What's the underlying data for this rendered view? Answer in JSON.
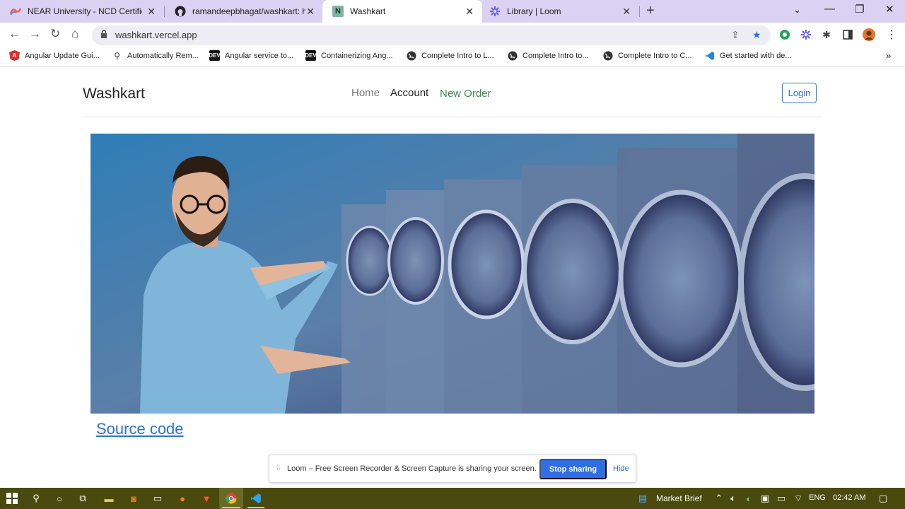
{
  "browser": {
    "tabs": [
      {
        "title": "NEAR University - NCD Certificate",
        "favicon": "near-icon"
      },
      {
        "title": "ramandeepbhagat/washkart: https",
        "favicon": "github-icon"
      },
      {
        "title": "Washkart",
        "favicon": "notion-n-icon"
      },
      {
        "title": "Library | Loom",
        "favicon": "loom-icon"
      }
    ],
    "url": "washkart.vercel.app",
    "bookmarks": [
      {
        "label": "Angular Update Gui...",
        "icon": "angular-icon"
      },
      {
        "label": "Automatically Rem...",
        "icon": "link-icon"
      },
      {
        "label": "Angular service to...",
        "icon": "dev-icon",
        "badge": "DEV"
      },
      {
        "label": "Containerizing Ang...",
        "icon": "dev-icon",
        "badge": "DEV"
      },
      {
        "label": "Complete Intro to L...",
        "icon": "globe-icon"
      },
      {
        "label": "Complete Intro to...",
        "icon": "globe-icon"
      },
      {
        "label": "Complete Intro to C...",
        "icon": "globe-icon"
      },
      {
        "label": "Get started with de...",
        "icon": "vscode-icon"
      }
    ],
    "more_bookmarks": "»"
  },
  "page": {
    "brand": "Washkart",
    "nav": {
      "home": "Home",
      "account": "Account",
      "new_order": "New Order"
    },
    "login": "Login",
    "source_link": "Source code"
  },
  "loom": {
    "grip": "⁞⁞",
    "message": "Loom – Free Screen Recorder & Screen Capture is sharing your screen.",
    "stop": "Stop sharing",
    "hide": "Hide"
  },
  "taskbar": {
    "market": "Market Brief",
    "lang": "ENG",
    "time": "02:42 AM"
  },
  "colors": {
    "accent": "#2e6fe6",
    "nav_green": "#3c8a52",
    "tab_strip": "#dbd1f2",
    "taskbar": "#4a4a0f"
  }
}
